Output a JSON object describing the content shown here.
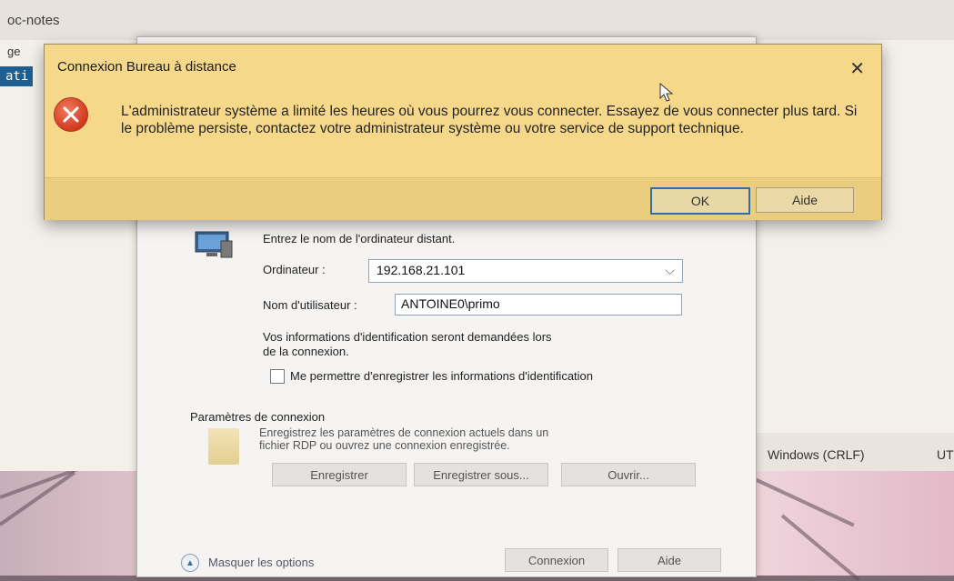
{
  "notepad": {
    "title_fragment": "oc-notes",
    "menu_fragment": "ge",
    "selected_fragment": "ati",
    "status": {
      "line_ending": "Windows (CRLF)",
      "encoding_fragment": "UT"
    }
  },
  "rdp": {
    "prompt": "Entrez le nom de l'ordinateur distant.",
    "computer_label": "Ordinateur :",
    "computer_value": "192.168.21.101",
    "user_label": "Nom d'utilisateur :",
    "user_value": "ANTOINE0\\primo",
    "credentials_note": "Vos informations d'identification seront demandées lors de la connexion.",
    "save_credentials_label": "Me permettre d'enregistrer les informations d'identification",
    "connection_settings_title": "Paramètres de connexion",
    "connection_settings_desc": "Enregistrez les paramètres de connexion actuels dans un fichier RDP ou ouvrez une connexion enregistrée.",
    "buttons": {
      "save": "Enregistrer",
      "save_as": "Enregistrer sous...",
      "open": "Ouvrir..."
    },
    "hide_options": "Masquer les options",
    "connect": "Connexion",
    "help": "Aide"
  },
  "dialog": {
    "title": "Connexion Bureau à distance",
    "message": "L'administrateur système a limité les heures où vous pourrez vous connecter. Essayez de vous connecter plus tard. Si le problème persiste, contactez votre administrateur système ou votre service de support technique.",
    "ok": "OK",
    "help": "Aide",
    "icon": "error-icon",
    "accent": "#f6d88a"
  }
}
